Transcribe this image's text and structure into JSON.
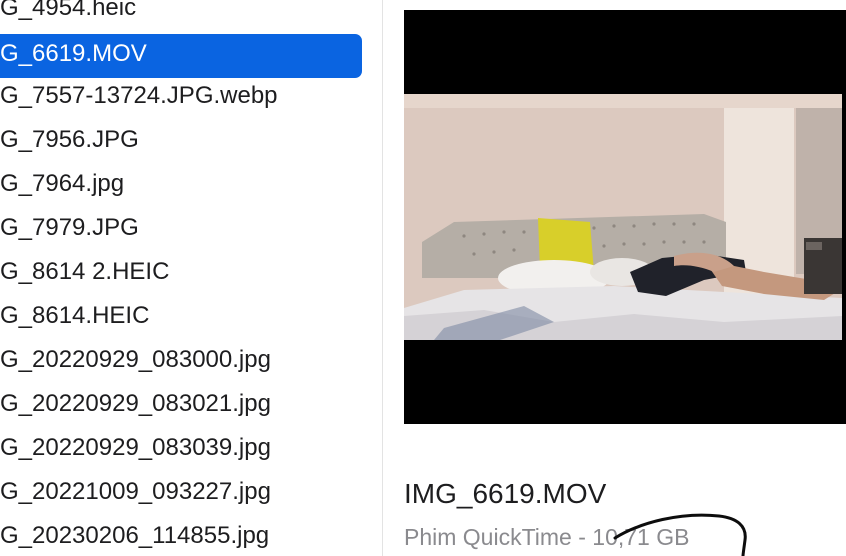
{
  "file_list": {
    "items": [
      {
        "label": "G_4954.heic",
        "selected": false
      },
      {
        "label": "G_6619.MOV",
        "selected": true
      },
      {
        "label": "G_7557-13724.JPG.webp",
        "selected": false
      },
      {
        "label": "G_7956.JPG",
        "selected": false
      },
      {
        "label": "G_7964.jpg",
        "selected": false
      },
      {
        "label": "G_7979.JPG",
        "selected": false
      },
      {
        "label": "G_8614 2.HEIC",
        "selected": false
      },
      {
        "label": "G_8614.HEIC",
        "selected": false
      },
      {
        "label": "G_20220929_083000.jpg",
        "selected": false
      },
      {
        "label": "G_20220929_083021.jpg",
        "selected": false
      },
      {
        "label": "G_20220929_083039.jpg",
        "selected": false
      },
      {
        "label": "G_20221009_093227.jpg",
        "selected": false
      },
      {
        "label": "G_20230206_114855.jpg",
        "selected": false
      }
    ]
  },
  "preview": {
    "file_name": "IMG_6619.MOV",
    "file_meta": "Phim QuickTime - 10,71 GB",
    "thumbnail_icon": "video-thumbnail"
  },
  "colors": {
    "selection": "#0a64e1",
    "meta_text": "#8a8a8e"
  }
}
